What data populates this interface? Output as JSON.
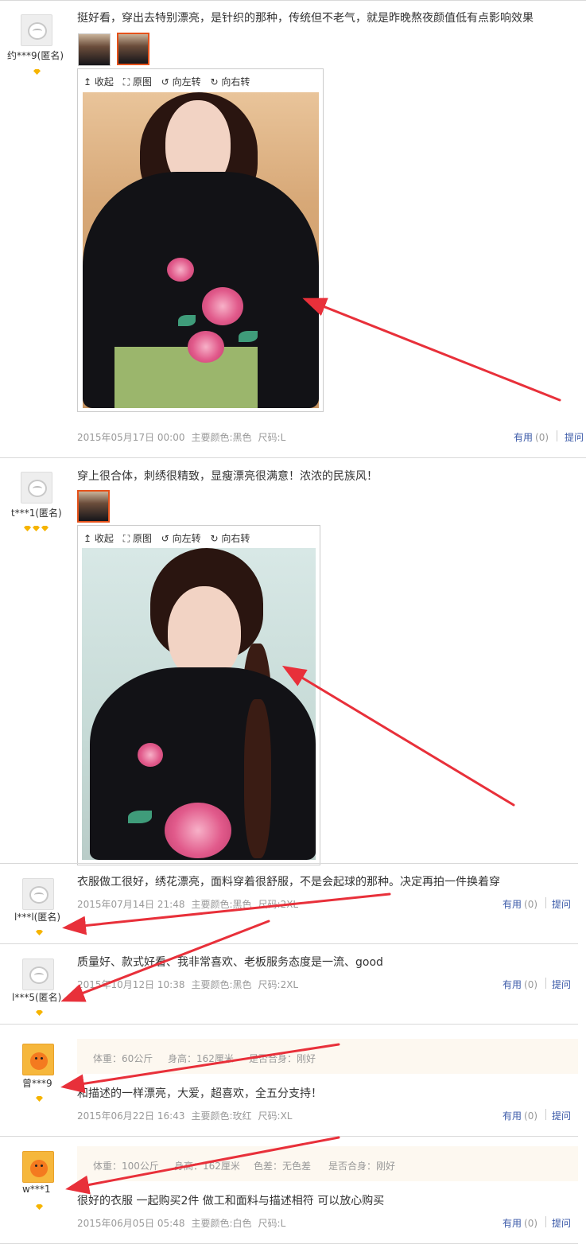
{
  "actions": {
    "useful": "有用",
    "useful_count": "(0)",
    "ask": "提问"
  },
  "viewer": {
    "collapse": "收起",
    "original": "原图",
    "rotate_left": "向左转",
    "rotate_right": "向右转"
  },
  "reviews": [
    {
      "user": "约***9(匿名)",
      "text": "挺好看，穿出去特别漂亮，是针织的那种，传统但不老气，就是昨晚熬夜颜值低有点影响效果",
      "date": "2015年05月17日 00:00",
      "color": "主要颜色:黑色",
      "size": "尺码:L"
    },
    {
      "user": "t***1(匿名)",
      "text": "穿上很合体，刺绣很精致，显瘦漂亮很满意！浓浓的民族风！"
    },
    {
      "user": "l***l(匿名)",
      "text": "衣服做工很好，绣花漂亮，面料穿着很舒服，不是会起球的那种。决定再拍一件换着穿",
      "date": "2015年07月14日 21:48",
      "color": "主要颜色:黑色",
      "size": "尺码:2XL"
    },
    {
      "user": "l***5(匿名)",
      "text": "质量好、款式好看、我非常喜欢、老板服务态度是一流、good",
      "date": "2015年10月12日 10:38",
      "color": "主要颜色:黑色",
      "size": "尺码:2XL"
    },
    {
      "user": "曾***9",
      "info": [
        "体重：60公斤",
        "身高：162厘米",
        "是否合身：刚好"
      ],
      "text": "和描述的一样漂亮，大爱，超喜欢，全五分支持！",
      "date": "2015年06月22日 16:43",
      "color": "主要颜色:玫红",
      "size": "尺码:XL"
    },
    {
      "user": "w***1",
      "info": [
        "体重：100公斤",
        "身高：162厘米",
        "色差：无色差",
        "是否合身：刚好"
      ],
      "text": "很好的衣服 一起购买2件 做工和面料与描述相符 可以放心购买",
      "date": "2015年06月05日 05:48",
      "color": "主要颜色:白色",
      "size": "尺码:L"
    }
  ],
  "annotation_color": "#e8303a"
}
